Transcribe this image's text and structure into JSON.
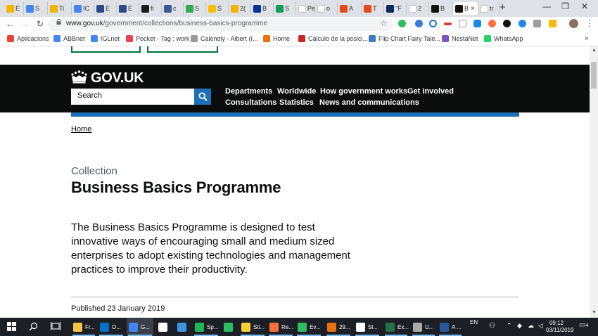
{
  "browser": {
    "tabs": [
      {
        "label": "E",
        "color": "#f4b400"
      },
      {
        "label": "S",
        "color": "#4285f4"
      },
      {
        "label": "Ti",
        "color": "#f4b400"
      },
      {
        "label": "IC",
        "color": "#4285f4"
      },
      {
        "label": "E",
        "color": "#2a4a8c"
      },
      {
        "label": "E",
        "color": "#2a4a8c"
      },
      {
        "label": "fi",
        "color": "#1a1a1a"
      },
      {
        "label": "c",
        "color": "#3b5998"
      },
      {
        "label": "S",
        "color": "#34a853"
      },
      {
        "label": "S",
        "color": "#fbbc05"
      },
      {
        "label": "2(",
        "color": "#f4b400"
      },
      {
        "label": "B",
        "color": "#003399"
      },
      {
        "label": "S",
        "color": "#0f9d58"
      },
      {
        "label": "Pesta",
        "color": "#ffffff"
      },
      {
        "label": "o",
        "color": "#ffffff"
      },
      {
        "label": "A",
        "color": "#e64a19"
      },
      {
        "label": "T",
        "color": "#e64a19"
      },
      {
        "label": "\"F",
        "color": "#0b2a5b"
      },
      {
        "label": "2",
        "color": "#ffffff"
      },
      {
        "label": "B",
        "color": "#111111"
      },
      {
        "label": "B",
        "color": "#111111"
      },
      {
        "label": "tr",
        "color": "#ffffff"
      }
    ],
    "active_tab": 20,
    "new_tab": "+",
    "win_minimize": "—",
    "win_restore": "❐",
    "win_close": "✕",
    "back": "←",
    "forward": "→",
    "reload": "↻",
    "url_domain": "www.gov.uk",
    "url_path": "/government/collections/business-basics-programme",
    "bookmarks": [
      {
        "label": "Aplicacions",
        "color": "#ea4335"
      },
      {
        "label": "ABBnet",
        "color": "#4285f4"
      },
      {
        "label": "IGLnet",
        "color": "#4285f4"
      },
      {
        "label": "Pocket - Tag : work",
        "color": "#ef4056"
      },
      {
        "label": "Calendly - Albert (I...",
        "color": "#999999"
      },
      {
        "label": "Home",
        "color": "#e8710a"
      },
      {
        "label": "Cálculo de la posici...",
        "color": "#c62828"
      },
      {
        "label": "Flip Chart Fairy Tale...",
        "color": "#3b7bbf"
      },
      {
        "label": "NestaNet",
        "color": "#7e57c2"
      },
      {
        "label": "WhatsApp",
        "color": "#25d366"
      }
    ],
    "bookmarks_more": "»"
  },
  "page": {
    "brand": "GOV.UK",
    "search_placeholder": "Search",
    "nav_row1": [
      "Departments",
      "Worldwide",
      "How government works",
      "Get involved"
    ],
    "nav_row2": [
      "Consultations",
      "Statistics",
      "News and communications"
    ],
    "breadcrumb": "Home",
    "caption": "Collection",
    "title": "Business Basics Programme",
    "lead_lines": [
      "The Business Basics Programme is designed to test",
      "innovative ways of encouraging small and medium sized",
      "enterprises to adopt existing technologies and management",
      "practices to improve their productivity."
    ],
    "published": "Published 23 January 2019",
    "colors": {
      "header": "#0b0c0c",
      "accent": "#1d70b8",
      "link_green": "#00703c"
    }
  },
  "taskbar": {
    "items": [
      {
        "label": "Fr...",
        "color": "#f4c542"
      },
      {
        "label": "O...",
        "color": "#0072c6"
      },
      {
        "label": "G...",
        "color": "#4285f4"
      },
      {
        "label": "",
        "color": "#ffffff"
      },
      {
        "label": "",
        "color": "#3a96dd"
      },
      {
        "label": "Sp...",
        "color": "#1db954"
      },
      {
        "label": "",
        "color": "#2dbe60"
      },
      {
        "label": "Sti...",
        "color": "#f7d038"
      },
      {
        "label": "Re...",
        "color": "#ff7139"
      },
      {
        "label": "Ev...",
        "color": "#2dbe60"
      },
      {
        "label": "29...",
        "color": "#e8710a"
      },
      {
        "label": "Sl...",
        "color": "#ffffff"
      },
      {
        "label": "Ex...",
        "color": "#217346"
      },
      {
        "label": "U...",
        "color": "#aaaaaa"
      },
      {
        "label": "A ...",
        "color": "#2b579a"
      }
    ],
    "lang": "EN",
    "time": "09:12",
    "date": "03/11/2019",
    "notifications": "4"
  }
}
